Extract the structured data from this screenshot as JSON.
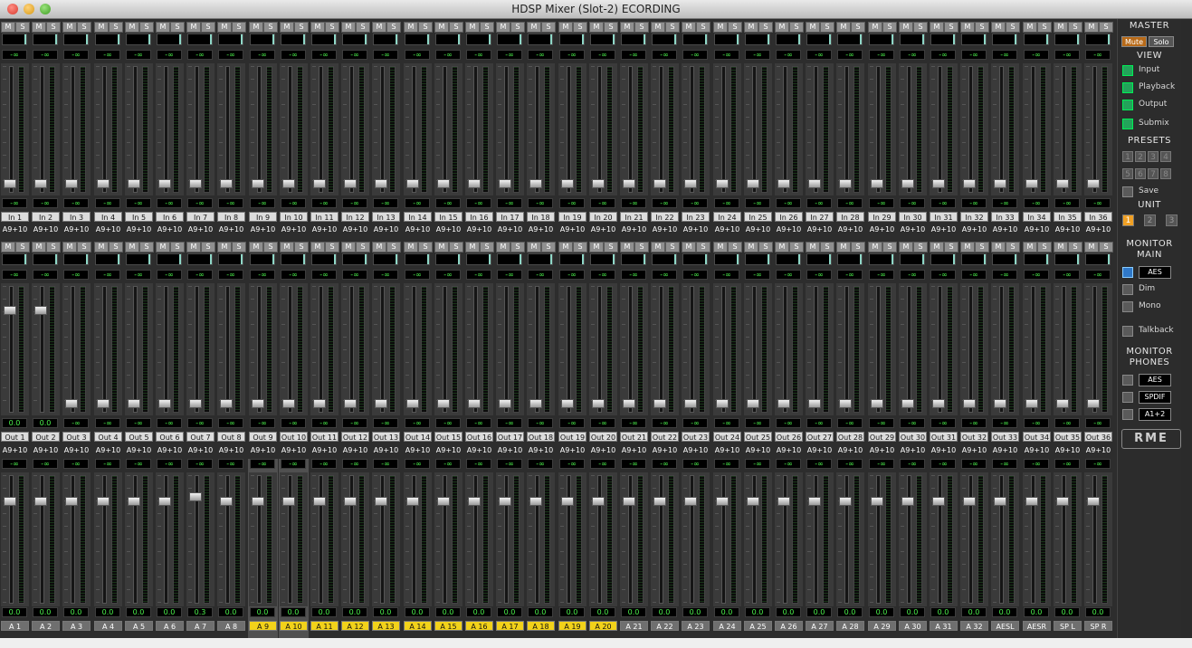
{
  "window": {
    "title": "HDSP Mixer (Slot-2) ECORDING"
  },
  "common": {
    "mute": "M",
    "solo": "S",
    "level_inf": "-∞",
    "source": "A9+10",
    "out_zero": "0.0"
  },
  "rows": {
    "input": {
      "labels": [
        "In 1",
        "In 2",
        "In 3",
        "In 4",
        "In 5",
        "In 6",
        "In 7",
        "In 8",
        "In 9",
        "In 10",
        "In 11",
        "In 12",
        "In 13",
        "In 14",
        "In 15",
        "In 16",
        "In 17",
        "In 18",
        "In 19",
        "In 20",
        "In 21",
        "In 22",
        "In 23",
        "In 24",
        "In 25",
        "In 26",
        "In 27",
        "In 28",
        "In 29",
        "In 30",
        "In 31",
        "In 32",
        "In 33",
        "In 34",
        "In 35",
        "In 36"
      ]
    },
    "playback": {
      "labels": [
        "Out 1",
        "Out 2",
        "Out 3",
        "Out 4",
        "Out 5",
        "Out 6",
        "Out 7",
        "Out 8",
        "Out 9",
        "Out 10",
        "Out 11",
        "Out 12",
        "Out 13",
        "Out 14",
        "Out 15",
        "Out 16",
        "Out 17",
        "Out 18",
        "Out 19",
        "Out 20",
        "Out 21",
        "Out 22",
        "Out 23",
        "Out 24",
        "Out 25",
        "Out 26",
        "Out 27",
        "Out 28",
        "Out 29",
        "Out 30",
        "Out 31",
        "Out 32",
        "Out 33",
        "Out 34",
        "Out 35",
        "Out 36"
      ],
      "gain_values": [
        "0.0",
        "0.0",
        "-∞",
        "-∞",
        "-∞",
        "-∞",
        "-∞",
        "-∞",
        "-∞",
        "-∞",
        "-∞",
        "-∞",
        "-∞",
        "-∞",
        "-∞",
        "-∞",
        "-∞",
        "-∞",
        "-∞",
        "-∞",
        "-∞",
        "-∞",
        "-∞",
        "-∞",
        "-∞",
        "-∞",
        "-∞",
        "-∞",
        "-∞",
        "-∞",
        "-∞",
        "-∞",
        "-∞",
        "-∞",
        "-∞",
        "-∞"
      ]
    },
    "output": {
      "labels": [
        "A 1",
        "A 2",
        "A 3",
        "A 4",
        "A 5",
        "A 6",
        "A 7",
        "A 8",
        "A 9",
        "A 10",
        "A 11",
        "A 12",
        "A 13",
        "A 14",
        "A 15",
        "A 16",
        "A 17",
        "A 18",
        "A 19",
        "A 20",
        "A 21",
        "A 22",
        "A 23",
        "A 24",
        "A 25",
        "A 26",
        "A 27",
        "A 28",
        "A 29",
        "A 30",
        "A 31",
        "A 32",
        "AESL",
        "AESR",
        "SP L",
        "SP R"
      ],
      "gain_values": [
        "0.0",
        "0.0",
        "0.0",
        "0.0",
        "0.0",
        "0.0",
        "0.3",
        "0.0",
        "0.0",
        "0.0",
        "0.0",
        "0.0",
        "0.0",
        "0.0",
        "0.0",
        "0.0",
        "0.0",
        "0.0",
        "0.0",
        "0.0",
        "0.0",
        "0.0",
        "0.0",
        "0.0",
        "0.0",
        "0.0",
        "0.0",
        "0.0",
        "0.0",
        "0.0",
        "0.0",
        "0.0",
        "0.0",
        "0.0",
        "0.0",
        "0.0"
      ],
      "highlighted": [
        "A 9",
        "A 10",
        "A 11",
        "A 12",
        "A 13",
        "A 14",
        "A 15",
        "A 16",
        "A 17",
        "A 18",
        "A 19",
        "A 20"
      ],
      "selected": [
        "A 9",
        "A 10"
      ]
    }
  },
  "sidebar": {
    "master": {
      "title": "MASTER",
      "mute": "Mute",
      "solo": "Solo"
    },
    "view": {
      "title": "VIEW",
      "items": [
        "Input",
        "Playback",
        "Output",
        "Submix"
      ]
    },
    "presets": {
      "title": "PRESETS",
      "buttons": [
        "1",
        "2",
        "3",
        "4",
        "5",
        "6",
        "7",
        "8"
      ],
      "save": "Save"
    },
    "unit": {
      "title": "UNIT",
      "buttons": [
        "1",
        "2",
        "3"
      ],
      "active": "1"
    },
    "monitor_main": {
      "title1": "MONITOR",
      "title2": "MAIN",
      "source": "AES",
      "dim": "Dim",
      "mono": "Mono",
      "talkback": "Talkback"
    },
    "monitor_phones": {
      "title1": "MONITOR",
      "title2": "PHONES",
      "sources": [
        "AES",
        "SPDIF",
        "A1+2"
      ]
    },
    "logo": "RME"
  },
  "colors": {
    "meter_green": "#4cf04c",
    "highlight_yellow": "#f2d21a",
    "view_active": "#23a35a",
    "unit_active": "#f0a024"
  }
}
